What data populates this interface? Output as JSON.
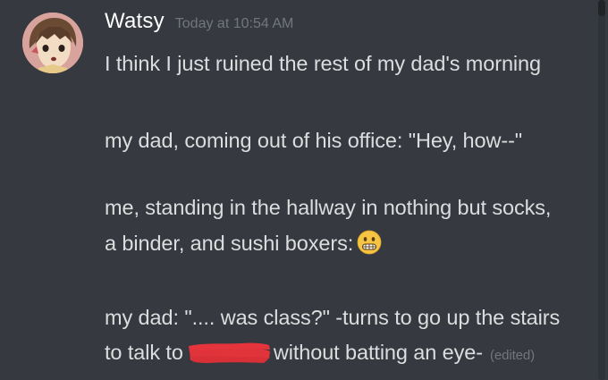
{
  "message": {
    "author": "Watsy",
    "timestamp": "Today at 10:54 AM",
    "lines": [
      "I think I just ruined the rest of my dad's morning",
      "my dad, coming out of his office: \"Hey, how--\"",
      "me, standing in the hallway in nothing but socks,",
      "a binder, and sushi boxers:",
      "my dad: \".... was class?\" -turns to go up the stairs",
      "to talk to",
      "without batting an eye-"
    ],
    "edited_label": "(edited)",
    "emoji": "grimacing-face"
  },
  "colors": {
    "background": "#36393f",
    "username": "#ffffff",
    "text": "#dcddde",
    "muted": "#72767d",
    "redaction": "#e5343b"
  }
}
